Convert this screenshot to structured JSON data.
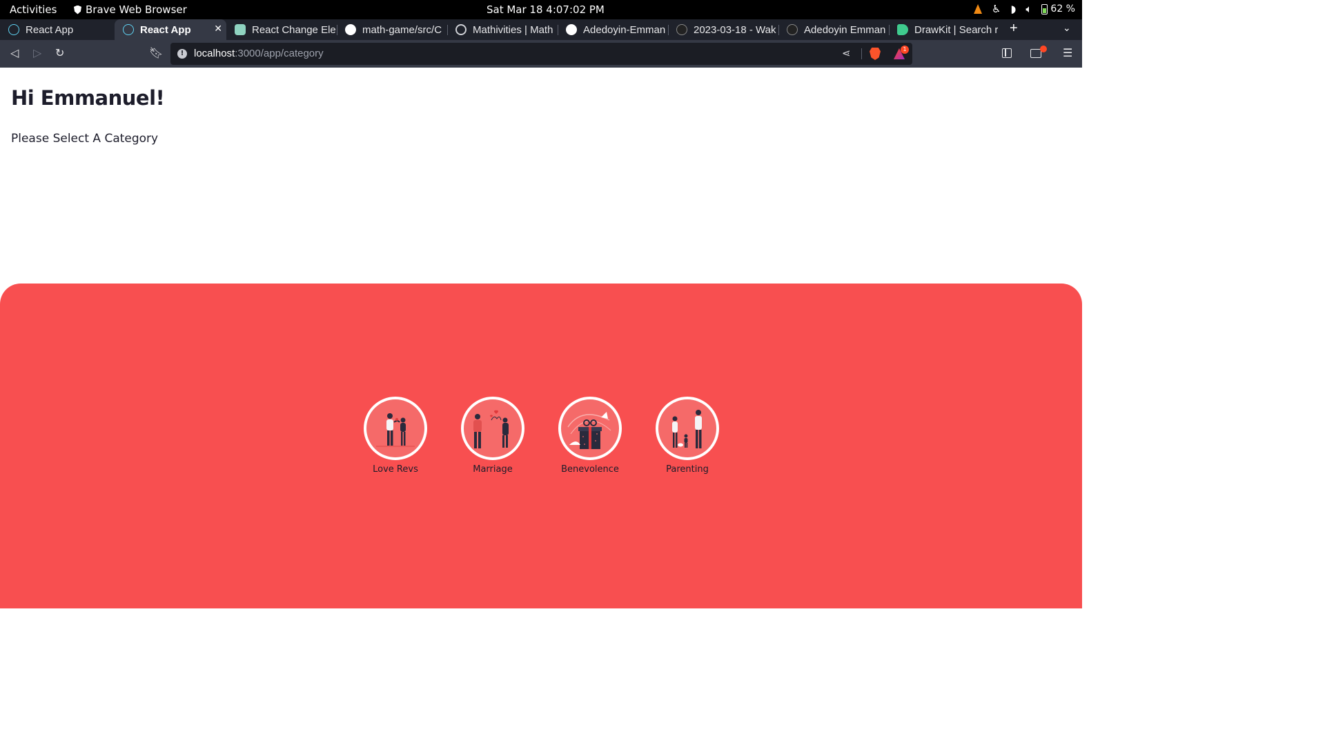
{
  "system_bar": {
    "activities": "Activities",
    "app_name": "Brave Web Browser",
    "datetime": "Sat Mar 18   4:07:02 PM",
    "battery": "62 %"
  },
  "tabs": [
    {
      "title": "React App",
      "icon": "react-icon",
      "active": false
    },
    {
      "title": "React App",
      "icon": "react-icon",
      "active": true
    },
    {
      "title": "React Change Ele",
      "icon": "chatgpt-icon",
      "active": false
    },
    {
      "title": "math-game/src/C",
      "icon": "github-icon",
      "active": false
    },
    {
      "title": "Mathivities | Math",
      "icon": "globe-icon",
      "active": false
    },
    {
      "title": "Adedoyin-Emman",
      "icon": "github-icon",
      "active": false
    },
    {
      "title": "2023-03-18 - Wak",
      "icon": "wakatime-icon",
      "active": false
    },
    {
      "title": "Adedoyin Emman",
      "icon": "wakatime-icon",
      "active": false
    },
    {
      "title": "DrawKit | Search r",
      "icon": "drawkit-icon",
      "active": false
    }
  ],
  "address_bar": {
    "host": "localhost",
    "path": ":3000/app/category",
    "rewards_badge": "1"
  },
  "page": {
    "greeting": "Hi Emmanuel!",
    "prompt": "Please Select A Category",
    "categories": [
      {
        "label": "Love Revs",
        "icon": "couple-illustration-icon"
      },
      {
        "label": "Marriage",
        "icon": "marriage-illustration-icon"
      },
      {
        "label": "Benevolence",
        "icon": "gift-illustration-icon"
      },
      {
        "label": "Parenting",
        "icon": "family-illustration-icon"
      }
    ]
  },
  "colors": {
    "accent_panel": "#f84f50",
    "circle_fill": "#f56a69",
    "text_dark": "#1d1d2b"
  }
}
